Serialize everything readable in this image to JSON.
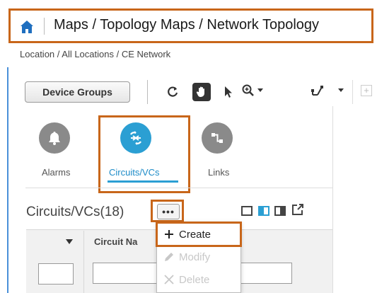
{
  "header": {
    "title": "Maps / Topology Maps / Network Topology"
  },
  "breadcrumb": "Location / All Locations / CE Network",
  "toolbar": {
    "device_groups_label": "Device Groups"
  },
  "tabs": [
    {
      "label": "Alarms",
      "icon": "bell-icon",
      "selected": false
    },
    {
      "label": "Circuits/VCs",
      "icon": "circuit-icon",
      "selected": true
    },
    {
      "label": "Links",
      "icon": "link-icon",
      "selected": false
    }
  ],
  "circuits": {
    "title": "Circuits/VCs(18)",
    "more_label": "•••",
    "columns": [
      "Circuit Na"
    ]
  },
  "dropdown": {
    "items": [
      {
        "label": "Create",
        "icon": "plus-icon",
        "enabled": true
      },
      {
        "label": "Modify",
        "icon": "pencil-icon",
        "enabled": false
      },
      {
        "label": "Delete",
        "icon": "x-icon",
        "enabled": false
      }
    ]
  },
  "colors": {
    "highlight": "#c8661a",
    "accent": "#2b9fd3",
    "home": "#1f6fbf"
  }
}
